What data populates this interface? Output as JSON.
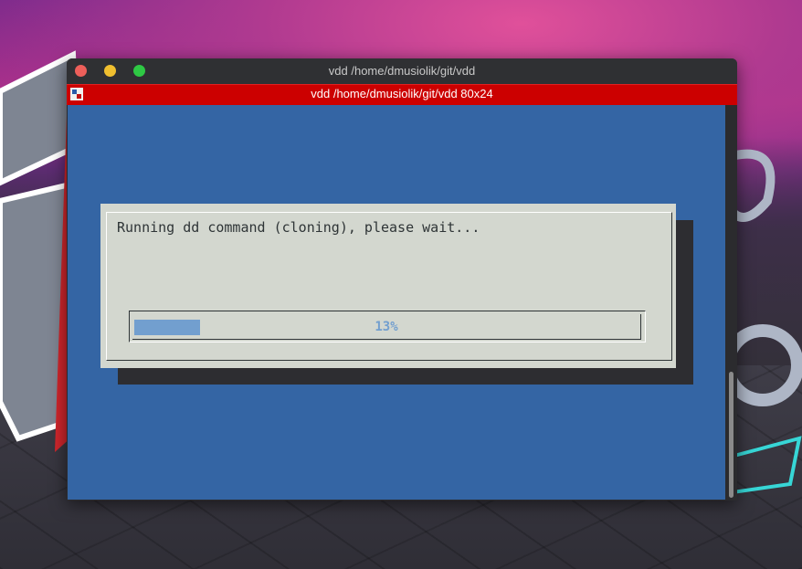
{
  "window": {
    "title": "vdd  /home/dmusiolik/git/vdd",
    "tab_title": "vdd  /home/dmusiolik/git/vdd 80x24"
  },
  "dialog": {
    "message": "Running dd command (cloning), please wait...",
    "progress_percent": 13,
    "progress_label": "13%"
  },
  "colors": {
    "terminal_bg": "#3465a4",
    "tab_bar": "#cc0000",
    "dialog_bg": "#d3d7cf",
    "gauge_fill": "#729fcf"
  },
  "icons": [
    "close-button-icon",
    "minimize-button-icon",
    "maximize-button-icon",
    "terminal-app-icon"
  ]
}
